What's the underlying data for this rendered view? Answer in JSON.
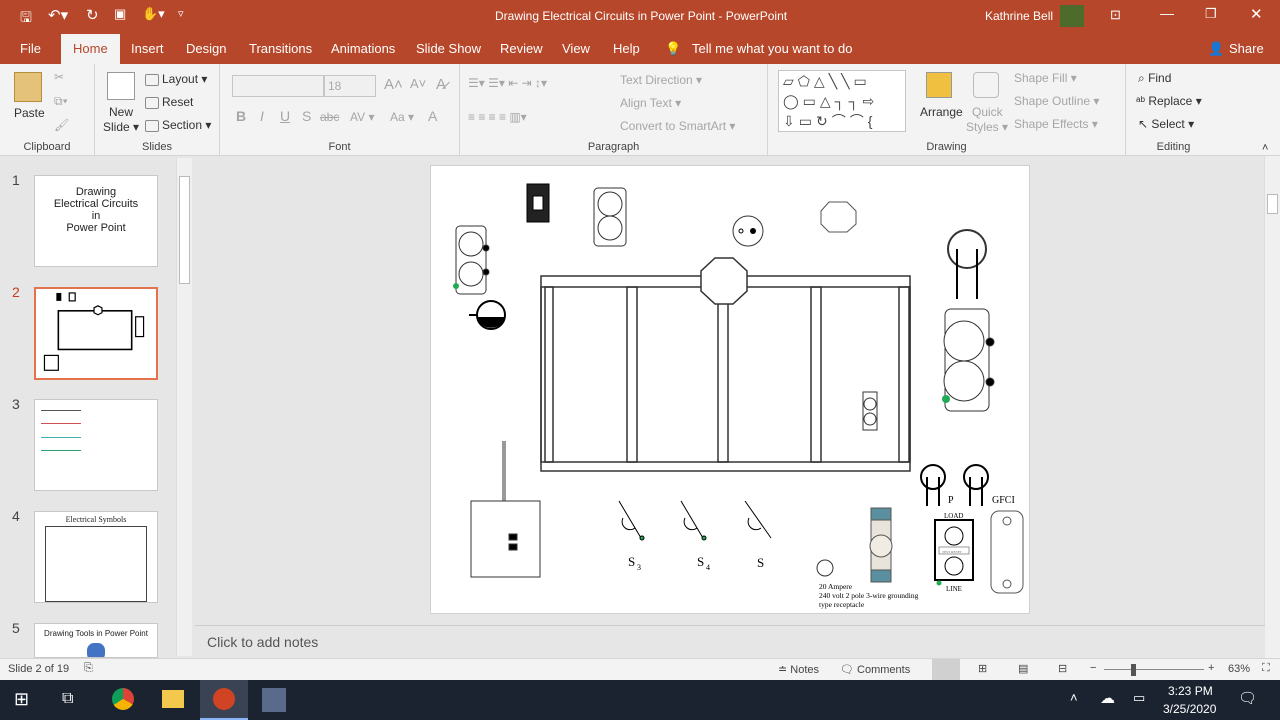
{
  "titlebar": {
    "title": "Drawing Electrical Circuits in Power Point  -  PowerPoint",
    "user": "Kathrine Bell",
    "share": "Share"
  },
  "tabs": [
    "File",
    "Home",
    "Insert",
    "Design",
    "Transitions",
    "Animations",
    "Slide Show",
    "Review",
    "View",
    "Help"
  ],
  "tell_me": "Tell me what you want to do",
  "ribbon": {
    "clipboard": {
      "label": "Clipboard",
      "paste": "Paste"
    },
    "slides": {
      "label": "Slides",
      "new_slide": "New",
      "new_slide2": "Slide ▾",
      "layout": "Layout ▾",
      "reset": "Reset",
      "section": "Section ▾"
    },
    "font": {
      "label": "Font",
      "size": "18",
      "bold": "B",
      "italic": "I",
      "underline": "U",
      "strike": "S",
      "shadow": "abc",
      "spacing": "AV ▾",
      "case": "Aa ▾",
      "clear": "A"
    },
    "paragraph": {
      "label": "Paragraph",
      "text_direction": "Text Direction ▾",
      "align_text": "Align Text ▾",
      "smartart": "Convert to SmartArt ▾"
    },
    "drawing": {
      "label": "Drawing",
      "arrange": "Arrange",
      "quick_styles": "Quick",
      "quick_styles2": "Styles ▾",
      "shape_fill": "Shape Fill ▾",
      "shape_outline": "Shape Outline ▾",
      "shape_effects": "Shape Effects ▾"
    },
    "editing": {
      "label": "Editing",
      "find": "Find",
      "replace": "Replace ▾",
      "select": "Select ▾"
    }
  },
  "thumbnails": [
    {
      "num": "1",
      "title": "Drawing\nElectrical Circuits\nin\nPower Point"
    },
    {
      "num": "2"
    },
    {
      "num": "3"
    },
    {
      "num": "4",
      "title": "Electrical Symbols"
    },
    {
      "num": "5",
      "title": "Drawing Tools in Power Point"
    }
  ],
  "slide": {
    "s3": "S",
    "s3sub": "3",
    "s4": "S",
    "s4sub": "4",
    "s": "S",
    "p": "P",
    "gfci": "GFCI",
    "load": "LOAD",
    "line": "LINE",
    "test_reset": "TEST  RESET",
    "amp1": "20 Ampere",
    "amp2": "240 volt 2 pole 3-wire grounding",
    "amp3": "type receptacle"
  },
  "notes_placeholder": "Click to add notes",
  "status": {
    "slide_of": "Slide 2 of 19",
    "notes": "Notes",
    "comments": "Comments",
    "zoom": "63%",
    "zoom_value": 63
  },
  "taskbar": {
    "time": "3:23 PM",
    "date": "3/25/2020"
  },
  "colors": {
    "accent": "#b7472a",
    "selected_thumb": "#e3734d"
  }
}
